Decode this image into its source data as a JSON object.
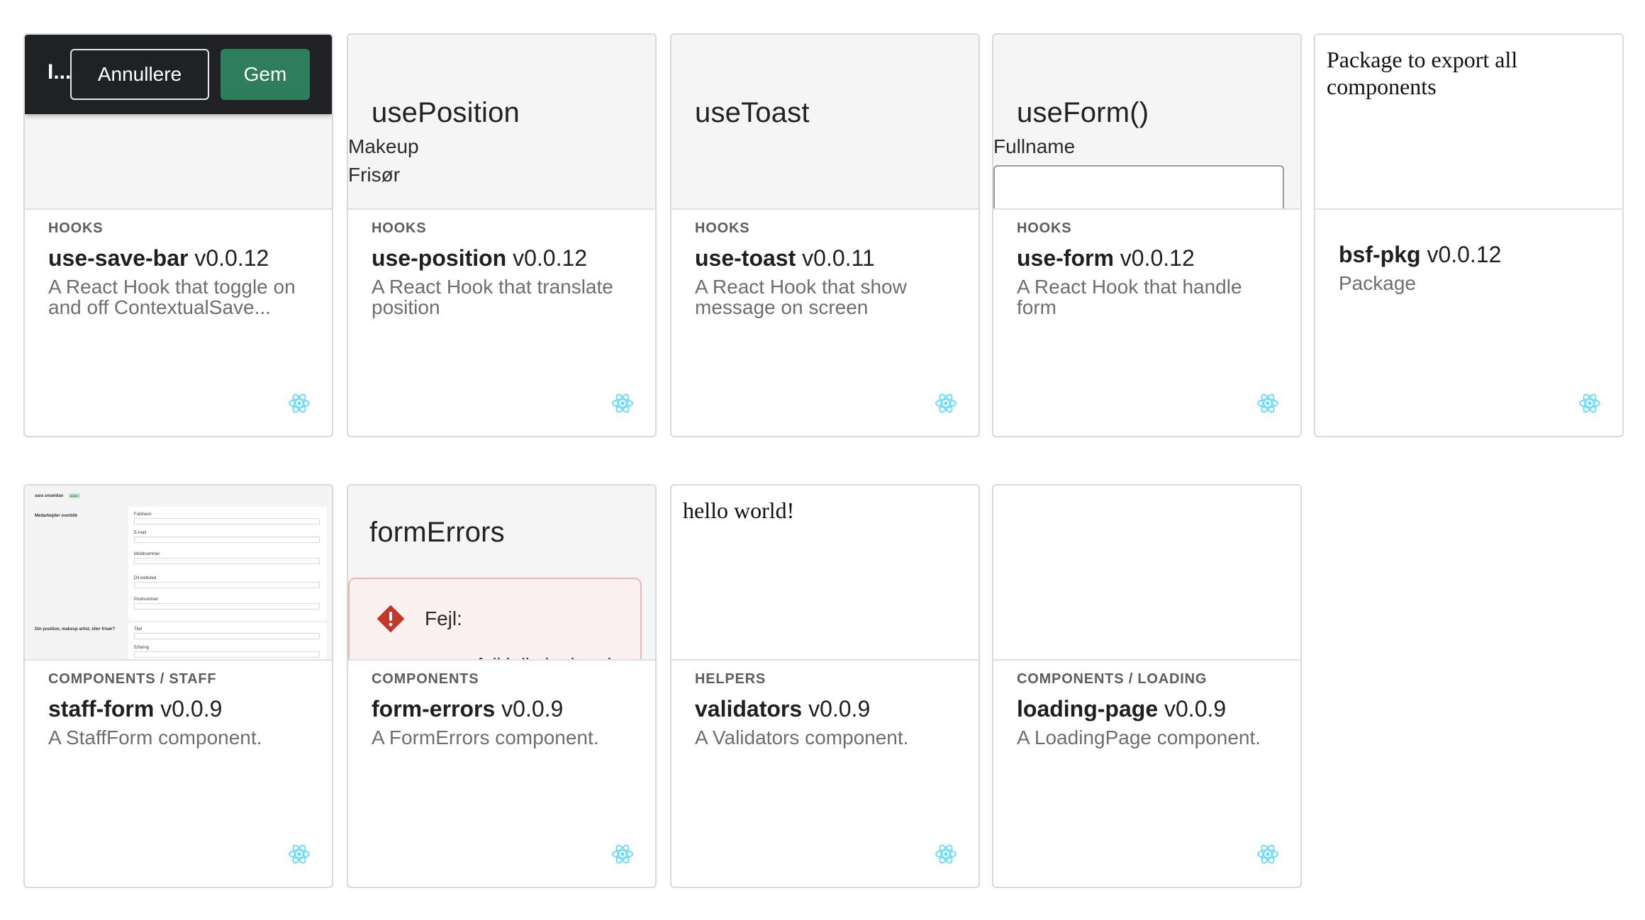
{
  "cards": [
    {
      "scope": "HOOKS",
      "name": "use-save-bar",
      "version": "v0.0.12",
      "description": "A React Hook that toggle on and off ContextualSave...",
      "preview": {
        "bar_text": "I...",
        "cancel_label": "Annullere",
        "save_label": "Gem"
      }
    },
    {
      "scope": "HOOKS",
      "name": "use-position",
      "version": "v0.0.12",
      "description": "A React Hook that translate position",
      "preview": {
        "title": "usePosition",
        "lines": [
          "Makeup",
          "Frisør"
        ]
      }
    },
    {
      "scope": "HOOKS",
      "name": "use-toast",
      "version": "v0.0.11",
      "description": "A React Hook that show message on screen",
      "preview": {
        "title": "useToast"
      }
    },
    {
      "scope": "HOOKS",
      "name": "use-form",
      "version": "v0.0.12",
      "description": "A React Hook that handle form",
      "preview": {
        "title": "useForm()",
        "field_label": "Fullname"
      }
    },
    {
      "scope": "",
      "name": "bsf-pkg",
      "version": "v0.0.12",
      "description": "Package",
      "preview": {
        "text": "Package to export all components"
      }
    },
    {
      "scope": "COMPONENTS / STAFF",
      "name": "staff-form",
      "version": "v0.0.9",
      "description": "A StaffForm component.",
      "preview": {
        "header": "sara soueidan",
        "badge": "Active",
        "section1": "Medarbejder overblik",
        "fields": [
          "Fuldnavn",
          "E-mail",
          "Mobilnummer",
          "Dit websted",
          "Postnummer"
        ],
        "section2": "Din position, makeup artist, eller frisør?",
        "fields2": [
          "Titel",
          "Erfaring"
        ]
      }
    },
    {
      "scope": "COMPONENTS",
      "name": "form-errors",
      "version": "v0.0.9",
      "description": "A FormErrors component.",
      "preview": {
        "title": "formErrors",
        "error_label": "Fejl:",
        "error_sub": "fejl i din kodeord"
      }
    },
    {
      "scope": "HELPERS",
      "name": "validators",
      "version": "v0.0.9",
      "description": "A Validators component.",
      "preview": {
        "text": "hello world!"
      }
    },
    {
      "scope": "COMPONENTS / LOADING",
      "name": "loading-page",
      "version": "v0.0.9",
      "description": "A LoadingPage component.",
      "preview": {}
    }
  ],
  "icons": {
    "framework": "react-icon",
    "error": "error-diamond-icon"
  },
  "colors": {
    "react": "#61dafb",
    "save_button": "#2e7d5b",
    "save_bar": "#1f2124",
    "error": "#c0392b"
  }
}
